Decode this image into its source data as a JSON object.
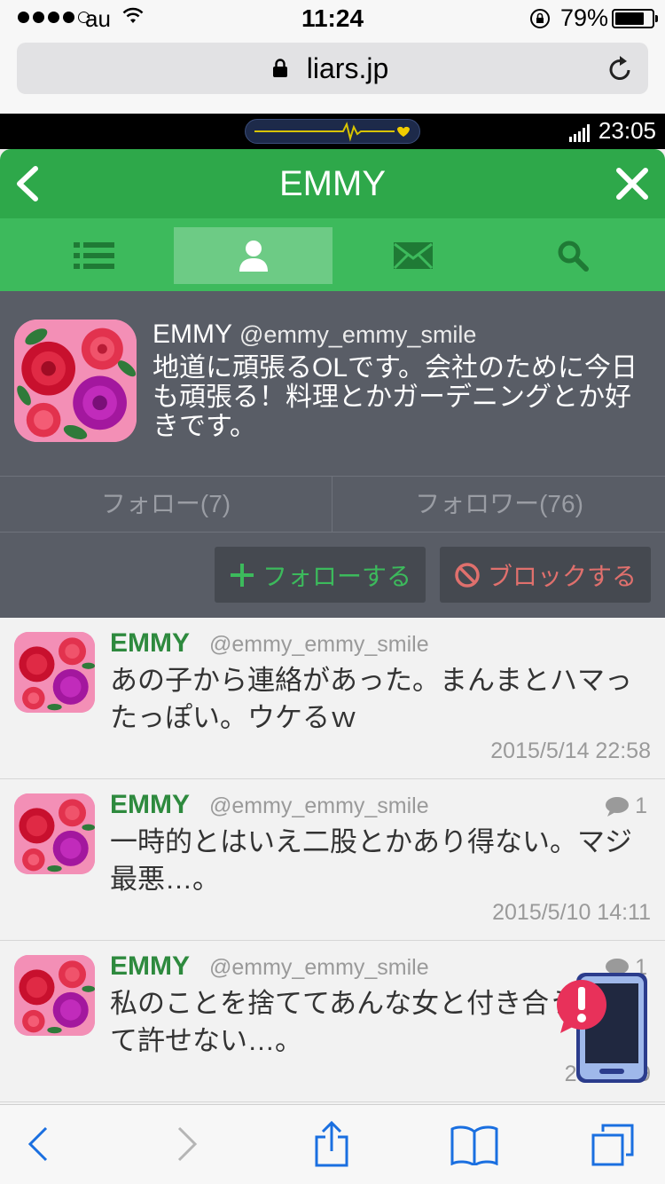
{
  "status_bar": {
    "carrier": "au",
    "time": "11:24",
    "battery_percent": "79%",
    "battery_level": 0.79
  },
  "browser": {
    "url": "liars.jp"
  },
  "game_bar": {
    "time": "23:05"
  },
  "header": {
    "title": "EMMY"
  },
  "tabs": [
    {
      "icon": "list-icon"
    },
    {
      "icon": "person-icon",
      "active": true
    },
    {
      "icon": "mail-icon"
    },
    {
      "icon": "search-icon"
    }
  ],
  "profile": {
    "name": "EMMY",
    "handle": "@emmy_emmy_smile",
    "bio": "地道に頑張るOLです。会社のために今日も頑張る！料理とかガーデニングとか好きです。",
    "follow_label": "フォロー(7)",
    "follower_label": "フォロワー(76)",
    "follow_button": "フォローする",
    "block_button": "ブロックする"
  },
  "posts": [
    {
      "name": "EMMY",
      "handle": "@emmy_emmy_smile",
      "text": "あの子から連絡があった。まんまとハマったっぽい。ウケるｗ",
      "date": "2015/5/14 22:58",
      "replies": ""
    },
    {
      "name": "EMMY",
      "handle": "@emmy_emmy_smile",
      "text": "一時的とはいえ二股とかあり得ない。マジ最悪…。",
      "date": "2015/5/10 14:11",
      "replies": "1"
    },
    {
      "name": "EMMY",
      "handle": "@emmy_emmy_smile",
      "text": "私のことを捨ててあんな女と付き合うなんて許せない…。",
      "date": "2015/5/9 ",
      "replies": "1"
    }
  ],
  "colors": {
    "header_green": "#2ea84a",
    "tab_green": "#3dba5c",
    "profile_bg": "#595d66",
    "follow_accent": "#3cba5c",
    "block_accent": "#e0706d"
  }
}
